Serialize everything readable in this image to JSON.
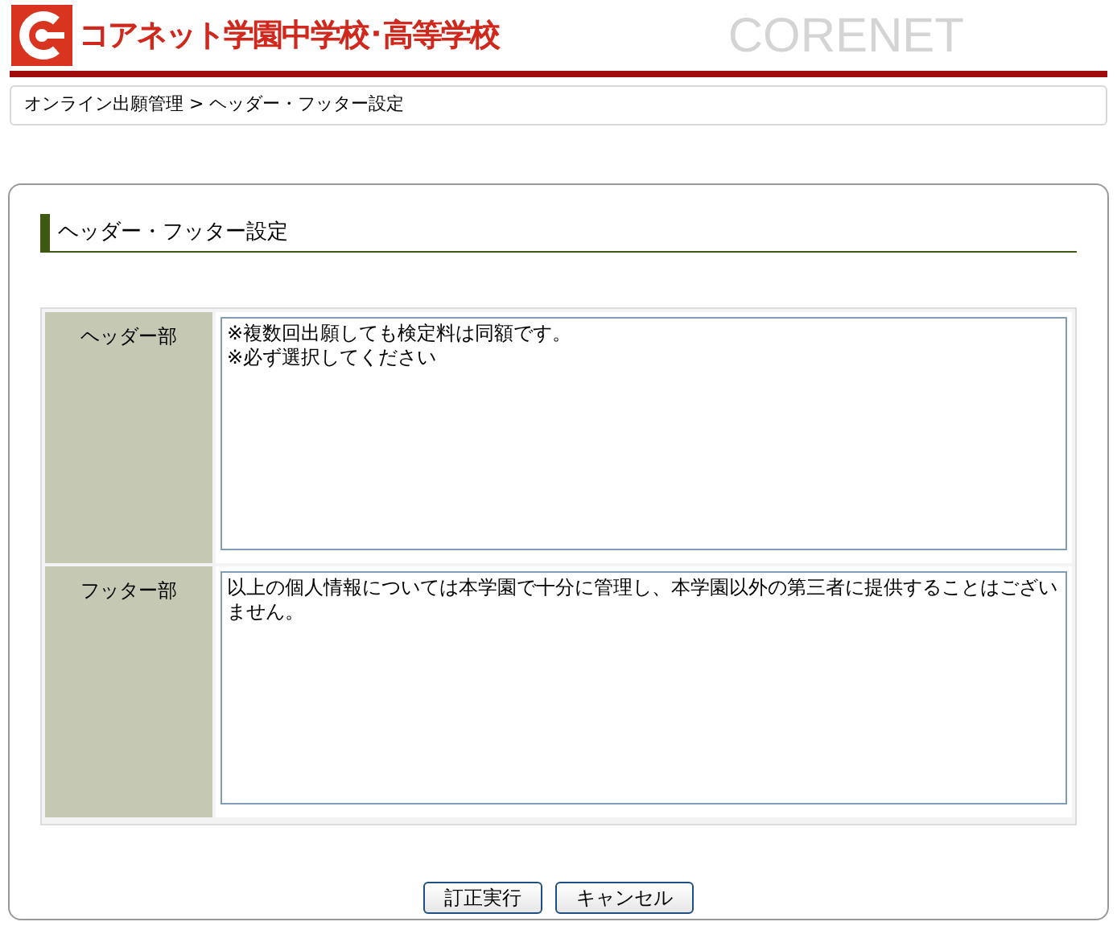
{
  "header": {
    "school_name": "コアネット学園中学校･高等学校",
    "brand": "CORENET"
  },
  "breadcrumb": "オンライン出願管理 > ヘッダー・フッター設定",
  "section_title": "ヘッダー・フッター設定",
  "form_rows": [
    {
      "label": "ヘッダー部",
      "value": "※複数回出願しても検定料は同額です。\n※必ず選択してください"
    },
    {
      "label": "フッター部",
      "value": "以上の個人情報については本学園で十分に管理し、本学園以外の第三者に提供することはございません。"
    }
  ],
  "buttons": [
    "訂正実行",
    "キャンセル"
  ]
}
